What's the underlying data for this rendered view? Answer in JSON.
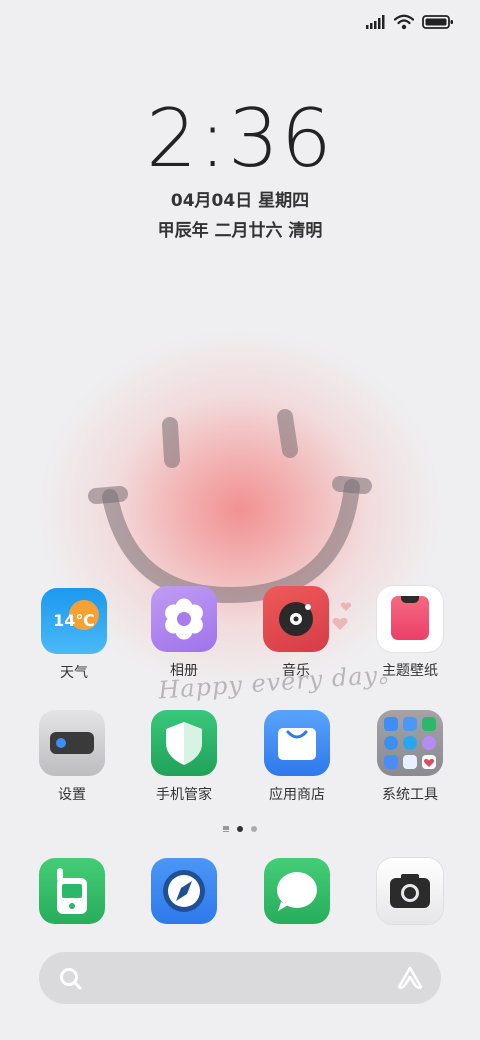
{
  "clock": {
    "time": "2:36"
  },
  "date": {
    "date_text": "04月04日 星期四",
    "lunar_text": "甲辰年 二月廿六 清明"
  },
  "wallpaper": {
    "handwriting": "Happy every day。"
  },
  "apps": {
    "weather": {
      "label": "天气",
      "temp": "14℃"
    },
    "album": {
      "label": "相册"
    },
    "music": {
      "label": "音乐"
    },
    "themes": {
      "label": "主题壁纸"
    },
    "settings": {
      "label": "设置"
    },
    "phone_manager": {
      "label": "手机管家"
    },
    "app_store": {
      "label": "应用商店"
    },
    "system_tools": {
      "label": "系统工具"
    }
  },
  "dock": [
    "phone",
    "browser",
    "messages",
    "camera"
  ],
  "page_indicator": {
    "pages": 2,
    "active_page": 1
  },
  "colors": {
    "weather_top": "#2aa6f0",
    "album": "#b58cf0",
    "music": "#e25050",
    "themes_accent": "#f0436c",
    "phone_manager": "#2cb86a",
    "app_store": "#3d8ef5",
    "dock_green": "#3cc46a",
    "browser_blue": "#3a86f0"
  }
}
